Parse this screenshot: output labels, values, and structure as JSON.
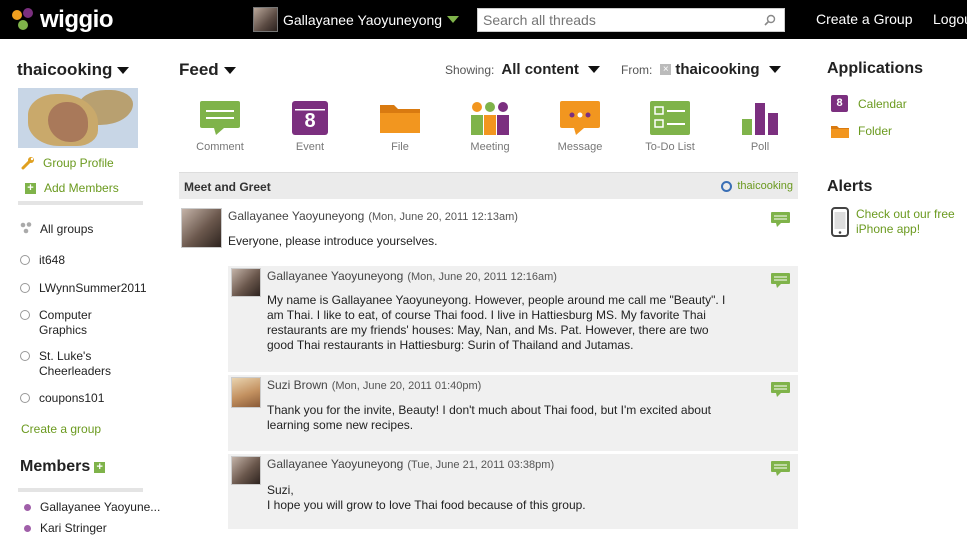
{
  "header": {
    "logo_text": "wiggio",
    "user_name": "Gallayanee Yaoyuneyong",
    "search_placeholder": "Search all threads",
    "create_group": "Create a Group",
    "logout": "Logout"
  },
  "sidebar": {
    "group_name": "thaicooking",
    "group_profile": "Group Profile",
    "add_members": "Add Members",
    "all_groups": "All groups",
    "groups": [
      "it648",
      "LWynnSummer2011",
      "Computer Graphics",
      "St. Luke's Cheerleaders",
      "coupons101"
    ],
    "create_group": "Create a group",
    "members_title": "Members",
    "members": [
      "Gallayanee Yaoyune...",
      "Kari Stringer"
    ]
  },
  "feed": {
    "title": "Feed",
    "showing_label": "Showing:",
    "showing_value": "All content",
    "from_label": "From:",
    "from_value": "thaicooking",
    "tools": [
      "Comment",
      "Event",
      "File",
      "Meeting",
      "Message",
      "To-Do List",
      "Poll"
    ],
    "event_day": "8"
  },
  "thread": {
    "title": "Meet and Greet",
    "group": "thaicooking",
    "posts": [
      {
        "author": "Gallayanee Yaoyuneyong",
        "date": "(Mon, June 20, 2011 12:13am)",
        "text": "Everyone, please introduce yourselves."
      },
      {
        "author": "Gallayanee Yaoyuneyong",
        "date": "(Mon, June 20, 2011 12:16am)",
        "text": "My name is Gallayanee Yaoyuneyong. However, people around me call me \"Beauty\". I am Thai. I like to eat, of course Thai food. I live in Hattiesburg MS. My favorite Thai restaurants are my friends' houses: May, Nan, and Ms. Pat. However, there are two good Thai restaurants in Hattiesburg: Surin of Thailand and Jutamas."
      },
      {
        "author": "Suzi Brown",
        "date": "(Mon, June 20, 2011 01:40pm)",
        "text": "Thank you for the invite, Beauty! I don't much about Thai food, but I'm excited about learning some new recipes."
      },
      {
        "author": "Gallayanee Yaoyuneyong",
        "date": "(Tue, June 21, 2011 03:38pm)",
        "text_line1": "Suzi,",
        "text_line2": "I hope you will grow to love Thai food because of this group."
      }
    ]
  },
  "right": {
    "applications_title": "Applications",
    "calendar": "Calendar",
    "calendar_day": "8",
    "folder": "Folder",
    "alerts_title": "Alerts",
    "alert_text": "Check out our free iPhone app!"
  },
  "colors": {
    "brand_green": "#7fb34a",
    "link_green": "#6b9a1f",
    "purple": "#7b2f7f",
    "orange": "#f2961f"
  }
}
